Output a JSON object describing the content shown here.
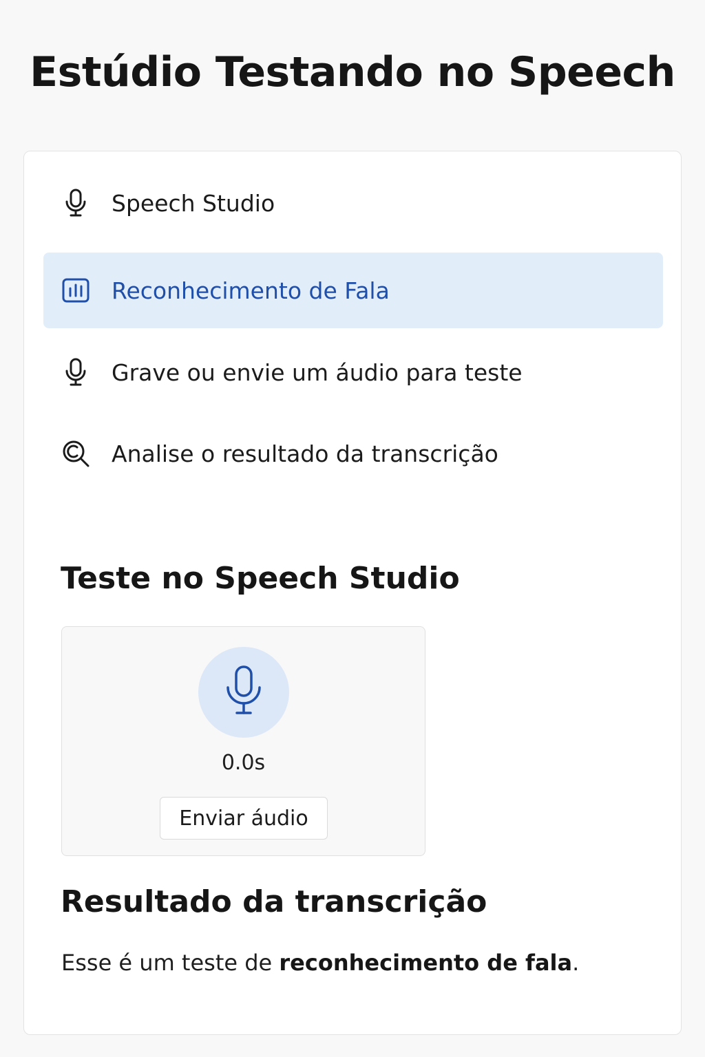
{
  "page": {
    "title": "Estúdio Testando no Speech"
  },
  "nav": {
    "items": [
      {
        "label": "Speech Studio",
        "icon": "microphone-icon",
        "active": false
      },
      {
        "label": "Reconhecimento de Fala",
        "icon": "bar-chart-icon",
        "active": true
      },
      {
        "label": "Grave ou envie um áudio para teste",
        "icon": "microphone-icon",
        "active": false
      },
      {
        "label": "Analise o resultado da transcrição",
        "icon": "search-analyze-icon",
        "active": false
      }
    ]
  },
  "test_section": {
    "heading": "Teste no Speech Studio",
    "mic_icon": "microphone-icon",
    "timer": "0.0s",
    "send_button_label": "Enviar áudio"
  },
  "result_section": {
    "heading": "Resultado da transcrição",
    "text_plain": "Esse é um teste de ",
    "text_bold": "reconhecimento de fala",
    "text_end": "."
  },
  "colors": {
    "accent": "#1f4fa8",
    "active_bg": "#e2edfa",
    "mic_circle_bg": "#dce8f8",
    "page_bg": "#f8f8f8",
    "card_bg": "#ffffff"
  }
}
